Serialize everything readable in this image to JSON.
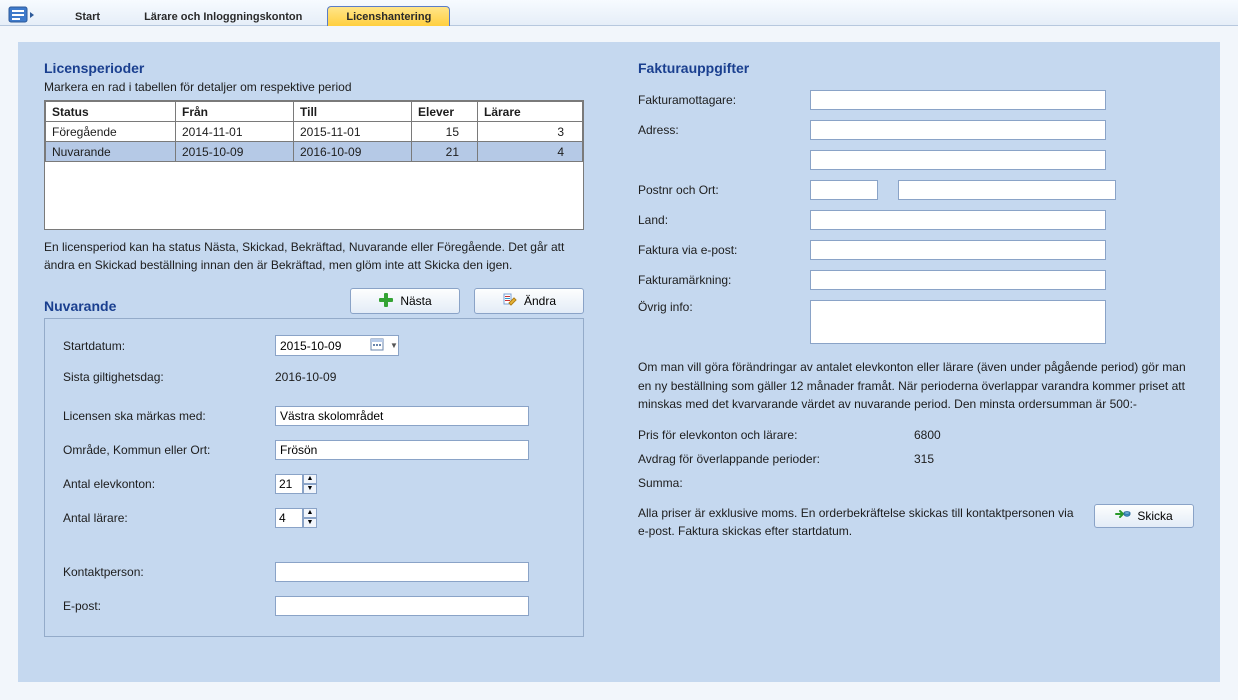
{
  "tabs": {
    "start": "Start",
    "teachers": "Lärare och Inloggningskonton",
    "license": "Licenshantering"
  },
  "left": {
    "periods_heading": "Licensperioder",
    "periods_sub": "Markera en rad i tabellen för detaljer om respektive period",
    "columns": {
      "status": "Status",
      "from": "Från",
      "to": "Till",
      "pupils": "Elever",
      "teachers": "Lärare"
    },
    "rows": [
      {
        "status": "Föregående",
        "from": "2014-11-01",
        "to": "2015-11-01",
        "pupils": "15",
        "teachers": "3",
        "selected": false
      },
      {
        "status": "Nuvarande",
        "from": "2015-10-09",
        "to": "2016-10-09",
        "pupils": "21",
        "teachers": "4",
        "selected": true
      }
    ],
    "table_note": "En licensperiod kan ha status Nästa, Skickad, Bekräftad, Nuvarande eller Föregående. Det går att ändra en Skickad beställning innan den är Bekräftad, men glöm inte att Skicka den igen.",
    "current_heading": "Nuvarande",
    "btn_next": "Nästa",
    "btn_edit": "Ändra",
    "form": {
      "start_label": "Startdatum:",
      "start_value": "2015-10-09",
      "end_label": "Sista giltighetsdag:",
      "end_value": "2016-10-09",
      "mark_label": "Licensen ska märkas med:",
      "mark_value": "Västra skolområdet",
      "area_label": "Område, Kommun eller Ort:",
      "area_value": "Frösön",
      "pupils_label": "Antal elevkonton:",
      "pupils_value": "21",
      "teachers_label": "Antal lärare:",
      "teachers_value": "4",
      "contact_label": "Kontaktperson:",
      "contact_value": "",
      "email_label": "E-post:",
      "email_value": ""
    }
  },
  "right": {
    "invoice_heading": "Fakturauppgifter",
    "recipient_label": "Fakturamottagare:",
    "recipient_value": "",
    "address_label": "Adress:",
    "address1_value": "",
    "address2_value": "",
    "post_label": "Postnr och Ort:",
    "post_value": "",
    "city_value": "",
    "country_label": "Land:",
    "country_value": "",
    "email_label": "Faktura via e-post:",
    "email_value": "",
    "marking_label": "Fakturamärkning:",
    "marking_value": "",
    "info_label": "Övrig info:",
    "info_value": "",
    "order_note": "Om man vill göra förändringar av antalet elevkonton eller lärare (även under pågående period) gör man en ny beställning som gäller 12 månader framåt. När perioderna överlappar varandra kommer priset att minskas med det kvarvarande värdet av nuvarande period. Den minsta ordersumman är 500:-",
    "price_label": "Pris för elevkonton och lärare:",
    "price_value": "6800",
    "deduct_label": "Avdrag för överlappande perioder:",
    "deduct_value": "315",
    "sum_label": "Summa:",
    "sum_value": "",
    "final_note": "Alla priser är exklusive moms. En orderbekräftelse skickas till kontaktpersonen via e-post. Faktura skickas efter startdatum.",
    "btn_send": "Skicka"
  }
}
